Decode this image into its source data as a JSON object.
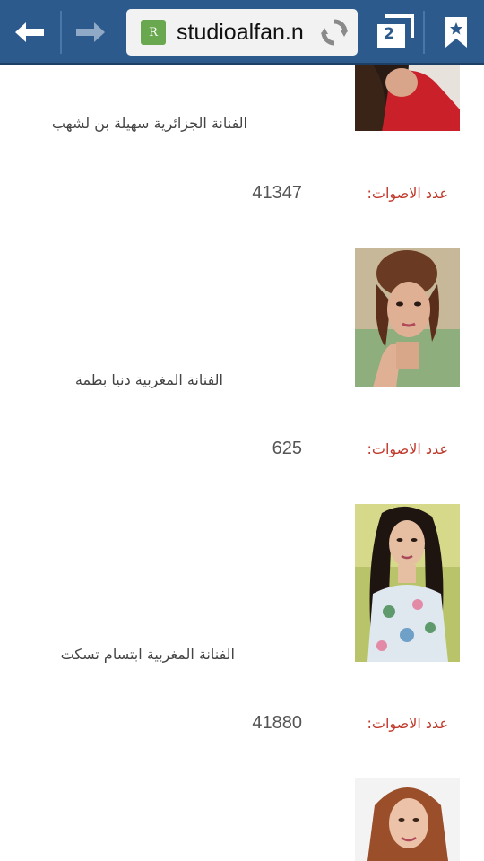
{
  "browser": {
    "url": "studioalfan.n",
    "tab_count": "2",
    "site_icon_letter": "R",
    "toolbar_color": "#2c5a8c"
  },
  "icons": [
    "back-arrow-icon",
    "forward-arrow-icon",
    "reload-icon",
    "tabs-icon",
    "bookmark-icon"
  ],
  "entries": [
    {
      "name": "الفنانة الجزائرية سهيلة بن لشهب",
      "votes_label": "عدد الاصوات:",
      "votes": "41347"
    },
    {
      "name": "الفنانة المغربية دنيا بطمة",
      "votes_label": "عدد الاصوات:",
      "votes": "625"
    },
    {
      "name": "الفنانة المغربية ابتسام تسكت",
      "votes_label": "عدد الاصوات:",
      "votes": "41880"
    },
    {
      "name": "",
      "votes_label": "",
      "votes": ""
    }
  ],
  "colors": {
    "votes_label": "#c0392b",
    "text": "#444444"
  }
}
